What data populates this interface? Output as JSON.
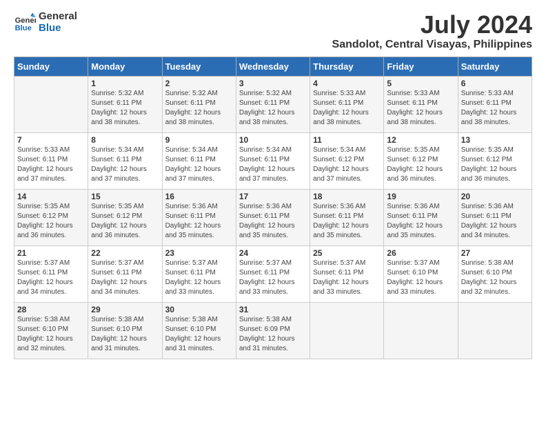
{
  "header": {
    "logo_line1": "General",
    "logo_line2": "Blue",
    "month_year": "July 2024",
    "location": "Sandolot, Central Visayas, Philippines"
  },
  "days_of_week": [
    "Sunday",
    "Monday",
    "Tuesday",
    "Wednesday",
    "Thursday",
    "Friday",
    "Saturday"
  ],
  "weeks": [
    [
      {
        "day": "",
        "sunrise": "",
        "sunset": "",
        "daylight": ""
      },
      {
        "day": "1",
        "sunrise": "Sunrise: 5:32 AM",
        "sunset": "Sunset: 6:11 PM",
        "daylight": "Daylight: 12 hours and 38 minutes."
      },
      {
        "day": "2",
        "sunrise": "Sunrise: 5:32 AM",
        "sunset": "Sunset: 6:11 PM",
        "daylight": "Daylight: 12 hours and 38 minutes."
      },
      {
        "day": "3",
        "sunrise": "Sunrise: 5:32 AM",
        "sunset": "Sunset: 6:11 PM",
        "daylight": "Daylight: 12 hours and 38 minutes."
      },
      {
        "day": "4",
        "sunrise": "Sunrise: 5:33 AM",
        "sunset": "Sunset: 6:11 PM",
        "daylight": "Daylight: 12 hours and 38 minutes."
      },
      {
        "day": "5",
        "sunrise": "Sunrise: 5:33 AM",
        "sunset": "Sunset: 6:11 PM",
        "daylight": "Daylight: 12 hours and 38 minutes."
      },
      {
        "day": "6",
        "sunrise": "Sunrise: 5:33 AM",
        "sunset": "Sunset: 6:11 PM",
        "daylight": "Daylight: 12 hours and 38 minutes."
      }
    ],
    [
      {
        "day": "7",
        "sunrise": "Sunrise: 5:33 AM",
        "sunset": "Sunset: 6:11 PM",
        "daylight": "Daylight: 12 hours and 37 minutes."
      },
      {
        "day": "8",
        "sunrise": "Sunrise: 5:34 AM",
        "sunset": "Sunset: 6:11 PM",
        "daylight": "Daylight: 12 hours and 37 minutes."
      },
      {
        "day": "9",
        "sunrise": "Sunrise: 5:34 AM",
        "sunset": "Sunset: 6:11 PM",
        "daylight": "Daylight: 12 hours and 37 minutes."
      },
      {
        "day": "10",
        "sunrise": "Sunrise: 5:34 AM",
        "sunset": "Sunset: 6:11 PM",
        "daylight": "Daylight: 12 hours and 37 minutes."
      },
      {
        "day": "11",
        "sunrise": "Sunrise: 5:34 AM",
        "sunset": "Sunset: 6:12 PM",
        "daylight": "Daylight: 12 hours and 37 minutes."
      },
      {
        "day": "12",
        "sunrise": "Sunrise: 5:35 AM",
        "sunset": "Sunset: 6:12 PM",
        "daylight": "Daylight: 12 hours and 36 minutes."
      },
      {
        "day": "13",
        "sunrise": "Sunrise: 5:35 AM",
        "sunset": "Sunset: 6:12 PM",
        "daylight": "Daylight: 12 hours and 36 minutes."
      }
    ],
    [
      {
        "day": "14",
        "sunrise": "Sunrise: 5:35 AM",
        "sunset": "Sunset: 6:12 PM",
        "daylight": "Daylight: 12 hours and 36 minutes."
      },
      {
        "day": "15",
        "sunrise": "Sunrise: 5:35 AM",
        "sunset": "Sunset: 6:12 PM",
        "daylight": "Daylight: 12 hours and 36 minutes."
      },
      {
        "day": "16",
        "sunrise": "Sunrise: 5:36 AM",
        "sunset": "Sunset: 6:11 PM",
        "daylight": "Daylight: 12 hours and 35 minutes."
      },
      {
        "day": "17",
        "sunrise": "Sunrise: 5:36 AM",
        "sunset": "Sunset: 6:11 PM",
        "daylight": "Daylight: 12 hours and 35 minutes."
      },
      {
        "day": "18",
        "sunrise": "Sunrise: 5:36 AM",
        "sunset": "Sunset: 6:11 PM",
        "daylight": "Daylight: 12 hours and 35 minutes."
      },
      {
        "day": "19",
        "sunrise": "Sunrise: 5:36 AM",
        "sunset": "Sunset: 6:11 PM",
        "daylight": "Daylight: 12 hours and 35 minutes."
      },
      {
        "day": "20",
        "sunrise": "Sunrise: 5:36 AM",
        "sunset": "Sunset: 6:11 PM",
        "daylight": "Daylight: 12 hours and 34 minutes."
      }
    ],
    [
      {
        "day": "21",
        "sunrise": "Sunrise: 5:37 AM",
        "sunset": "Sunset: 6:11 PM",
        "daylight": "Daylight: 12 hours and 34 minutes."
      },
      {
        "day": "22",
        "sunrise": "Sunrise: 5:37 AM",
        "sunset": "Sunset: 6:11 PM",
        "daylight": "Daylight: 12 hours and 34 minutes."
      },
      {
        "day": "23",
        "sunrise": "Sunrise: 5:37 AM",
        "sunset": "Sunset: 6:11 PM",
        "daylight": "Daylight: 12 hours and 33 minutes."
      },
      {
        "day": "24",
        "sunrise": "Sunrise: 5:37 AM",
        "sunset": "Sunset: 6:11 PM",
        "daylight": "Daylight: 12 hours and 33 minutes."
      },
      {
        "day": "25",
        "sunrise": "Sunrise: 5:37 AM",
        "sunset": "Sunset: 6:11 PM",
        "daylight": "Daylight: 12 hours and 33 minutes."
      },
      {
        "day": "26",
        "sunrise": "Sunrise: 5:37 AM",
        "sunset": "Sunset: 6:10 PM",
        "daylight": "Daylight: 12 hours and 33 minutes."
      },
      {
        "day": "27",
        "sunrise": "Sunrise: 5:38 AM",
        "sunset": "Sunset: 6:10 PM",
        "daylight": "Daylight: 12 hours and 32 minutes."
      }
    ],
    [
      {
        "day": "28",
        "sunrise": "Sunrise: 5:38 AM",
        "sunset": "Sunset: 6:10 PM",
        "daylight": "Daylight: 12 hours and 32 minutes."
      },
      {
        "day": "29",
        "sunrise": "Sunrise: 5:38 AM",
        "sunset": "Sunset: 6:10 PM",
        "daylight": "Daylight: 12 hours and 31 minutes."
      },
      {
        "day": "30",
        "sunrise": "Sunrise: 5:38 AM",
        "sunset": "Sunset: 6:10 PM",
        "daylight": "Daylight: 12 hours and 31 minutes."
      },
      {
        "day": "31",
        "sunrise": "Sunrise: 5:38 AM",
        "sunset": "Sunset: 6:09 PM",
        "daylight": "Daylight: 12 hours and 31 minutes."
      },
      {
        "day": "",
        "sunrise": "",
        "sunset": "",
        "daylight": ""
      },
      {
        "day": "",
        "sunrise": "",
        "sunset": "",
        "daylight": ""
      },
      {
        "day": "",
        "sunrise": "",
        "sunset": "",
        "daylight": ""
      }
    ]
  ]
}
